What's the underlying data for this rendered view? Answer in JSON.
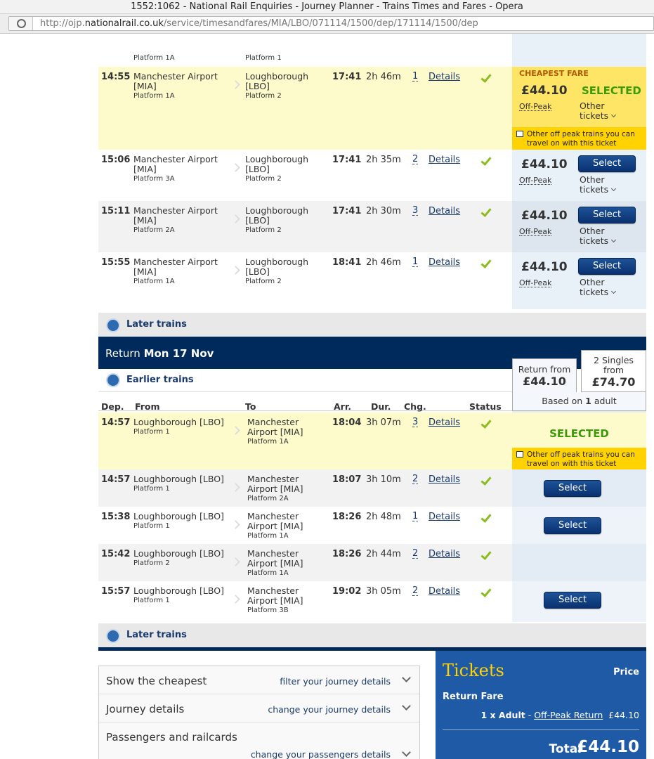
{
  "browser": {
    "title": "1552:1062 - National Rail Enquiries - Journey Planner - Trains Times and Fares - Opera",
    "url_prefix": "http://ojp.",
    "url_domain": "nationalrail.co.uk",
    "url_path": "/service/timesandfares/MIA/LBO/071114/1500/dep/171114/1500/dep"
  },
  "partial_row": {
    "from_platform": "Platform 1A",
    "to_platform": "Platform 1"
  },
  "outbound": [
    {
      "dep": "14:55",
      "from": "Manchester Airport",
      "from_code": "[MIA]",
      "from_platform": "Platform 1A",
      "to": "Loughborough",
      "to_code": "[LBO]",
      "to_platform": "Platform 2",
      "arr": "17:41",
      "dur": "2h 46m",
      "chg": "1",
      "details": "Details",
      "price": "£44.10",
      "fare_type": "Off-Peak",
      "other": "Other",
      "other2": "tickets",
      "selected": "SELECTED",
      "cheapest": "CHEAPEST FARE",
      "banner": "Other off peak trains you can travel on with this ticket"
    },
    {
      "dep": "15:06",
      "from": "Manchester Airport",
      "from_code": "[MIA]",
      "from_platform": "Platform 3A",
      "to": "Loughborough",
      "to_code": "[LBO]",
      "to_platform": "Platform 2",
      "arr": "17:41",
      "dur": "2h 35m",
      "chg": "2",
      "details": "Details",
      "price": "£44.10",
      "fare_type": "Off-Peak",
      "other": "Other",
      "other2": "tickets",
      "select": "Select"
    },
    {
      "dep": "15:11",
      "from": "Manchester Airport",
      "from_code": "[MIA]",
      "from_platform": "Platform 2A",
      "to": "Loughborough",
      "to_code": "[LBO]",
      "to_platform": "Platform 2",
      "arr": "17:41",
      "dur": "2h 30m",
      "chg": "3",
      "details": "Details",
      "price": "£44.10",
      "fare_type": "Off-Peak",
      "other": "Other",
      "other2": "tickets",
      "select": "Select"
    },
    {
      "dep": "15:55",
      "from": "Manchester Airport",
      "from_code": "[MIA]",
      "from_platform": "Platform 1A",
      "to": "Loughborough",
      "to_code": "[LBO]",
      "to_platform": "Platform 2",
      "arr": "18:41",
      "dur": "2h 46m",
      "chg": "1",
      "details": "Details",
      "price": "£44.10",
      "fare_type": "Off-Peak",
      "other": "Other",
      "other2": "tickets",
      "select": "Select"
    }
  ],
  "later_trains": "Later trains",
  "return": {
    "label": "Return",
    "date": "Mon 17 Nov",
    "earlier_trains": "Earlier trains",
    "return_box": {
      "line1": "Return from",
      "price": "£44.10"
    },
    "singles_box": {
      "line1": "2 Singles",
      "line2": "from",
      "price": "£74.70"
    },
    "based_on_prefix": "Based on",
    "based_on_count": "1",
    "based_on_suffix": "adult"
  },
  "columns": {
    "dep": "Dep.",
    "from": "From",
    "to": "To",
    "arr": "Arr.",
    "dur": "Dur.",
    "chg": "Chg.",
    "status": "Status"
  },
  "return_trains": [
    {
      "dep": "14:57",
      "from": "Loughborough [LBO]",
      "from_platform": "Platform 1",
      "to": "Manchester",
      "to2": "Airport [MIA]",
      "to_platform": "Platform 1A",
      "arr": "18:04",
      "dur": "3h 07m",
      "chg": "3",
      "details": "Details",
      "selected": "SELECTED",
      "banner": "Other off peak trains you can travel on with this ticket"
    },
    {
      "dep": "14:57",
      "from": "Loughborough [LBO]",
      "from_platform": "Platform 1",
      "to": "Manchester",
      "to2": "Airport [MIA]",
      "to_platform": "Platform 2A",
      "arr": "18:07",
      "dur": "3h 10m",
      "chg": "2",
      "details": "Details",
      "select": "Select"
    },
    {
      "dep": "15:38",
      "from": "Loughborough [LBO]",
      "from_platform": "Platform 1",
      "to": "Manchester",
      "to2": "Airport [MIA]",
      "to_platform": "Platform 1A",
      "arr": "18:26",
      "dur": "2h 48m",
      "chg": "1",
      "details": "Details",
      "select": "Select"
    },
    {
      "dep": "15:42",
      "from": "Loughborough [LBO]",
      "from_platform": "Platform 2",
      "to": "Manchester",
      "to2": "Airport [MIA]",
      "to_platform": "Platform 1A",
      "arr": "18:26",
      "dur": "2h 44m",
      "chg": "2",
      "details": "Details"
    },
    {
      "dep": "15:57",
      "from": "Loughborough [LBO]",
      "from_platform": "Platform 1",
      "to": "Manchester",
      "to2": "Airport [MIA]",
      "to_platform": "Platform 3B",
      "arr": "19:02",
      "dur": "3h 05m",
      "chg": "2",
      "details": "Details",
      "select": "Select"
    }
  ],
  "accordion": [
    {
      "title": "Show the cheapest",
      "link": "filter your journey details"
    },
    {
      "title": "Journey details",
      "link": "change your journey details"
    },
    {
      "title": "Passengers and railcards",
      "link": "change your passengers details"
    }
  ],
  "tickets": {
    "title": "Tickets",
    "price_header": "Price",
    "return_fare": "Return Fare",
    "qty": "1 x Adult",
    "sep": "-",
    "ticket_type": "Off-Peak Return",
    "line_price": "£44.10",
    "total_label": "Total",
    "total_value": "£44.10"
  },
  "colors": {
    "navy": "#002a5c",
    "yellow": "#ffd200",
    "highlight": "#fdfbcc",
    "fare_bg": "#e3ecf4",
    "check_green": "#8cbc1e",
    "tickets_blue": "#1f5aa6"
  }
}
